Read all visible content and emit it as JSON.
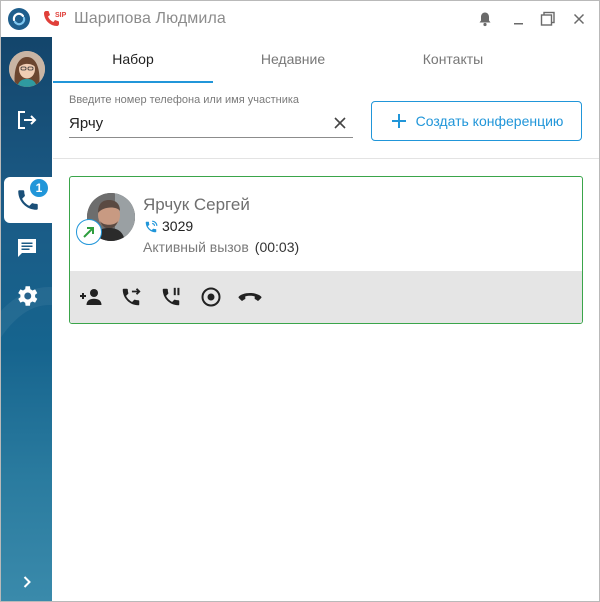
{
  "window": {
    "title": "Шарипова Людмила",
    "sip_label": "SIP"
  },
  "sidebar": {
    "calls_badge": "1",
    "items": [
      {
        "name": "avatar"
      },
      {
        "name": "exit-icon"
      },
      {
        "name": "phone-icon"
      },
      {
        "name": "chat-icon"
      },
      {
        "name": "gear-icon"
      },
      {
        "name": "chevron-right-icon"
      }
    ]
  },
  "tabs": [
    {
      "label": "Набор"
    },
    {
      "label": "Недавние"
    },
    {
      "label": "Контакты"
    }
  ],
  "search": {
    "label": "Введите номер телефона или имя участника",
    "value": "Ярчу"
  },
  "conference_button": {
    "label": "Создать конференцию"
  },
  "call": {
    "name": "Ярчук Сергей",
    "number": "3029",
    "status": "Активный вызов",
    "duration": "(00:03)"
  },
  "colors": {
    "accent": "#2196d9",
    "sidebar": "#1b5b86",
    "active_call_border": "#3aa54a",
    "sip_icon": "#e0403a"
  }
}
